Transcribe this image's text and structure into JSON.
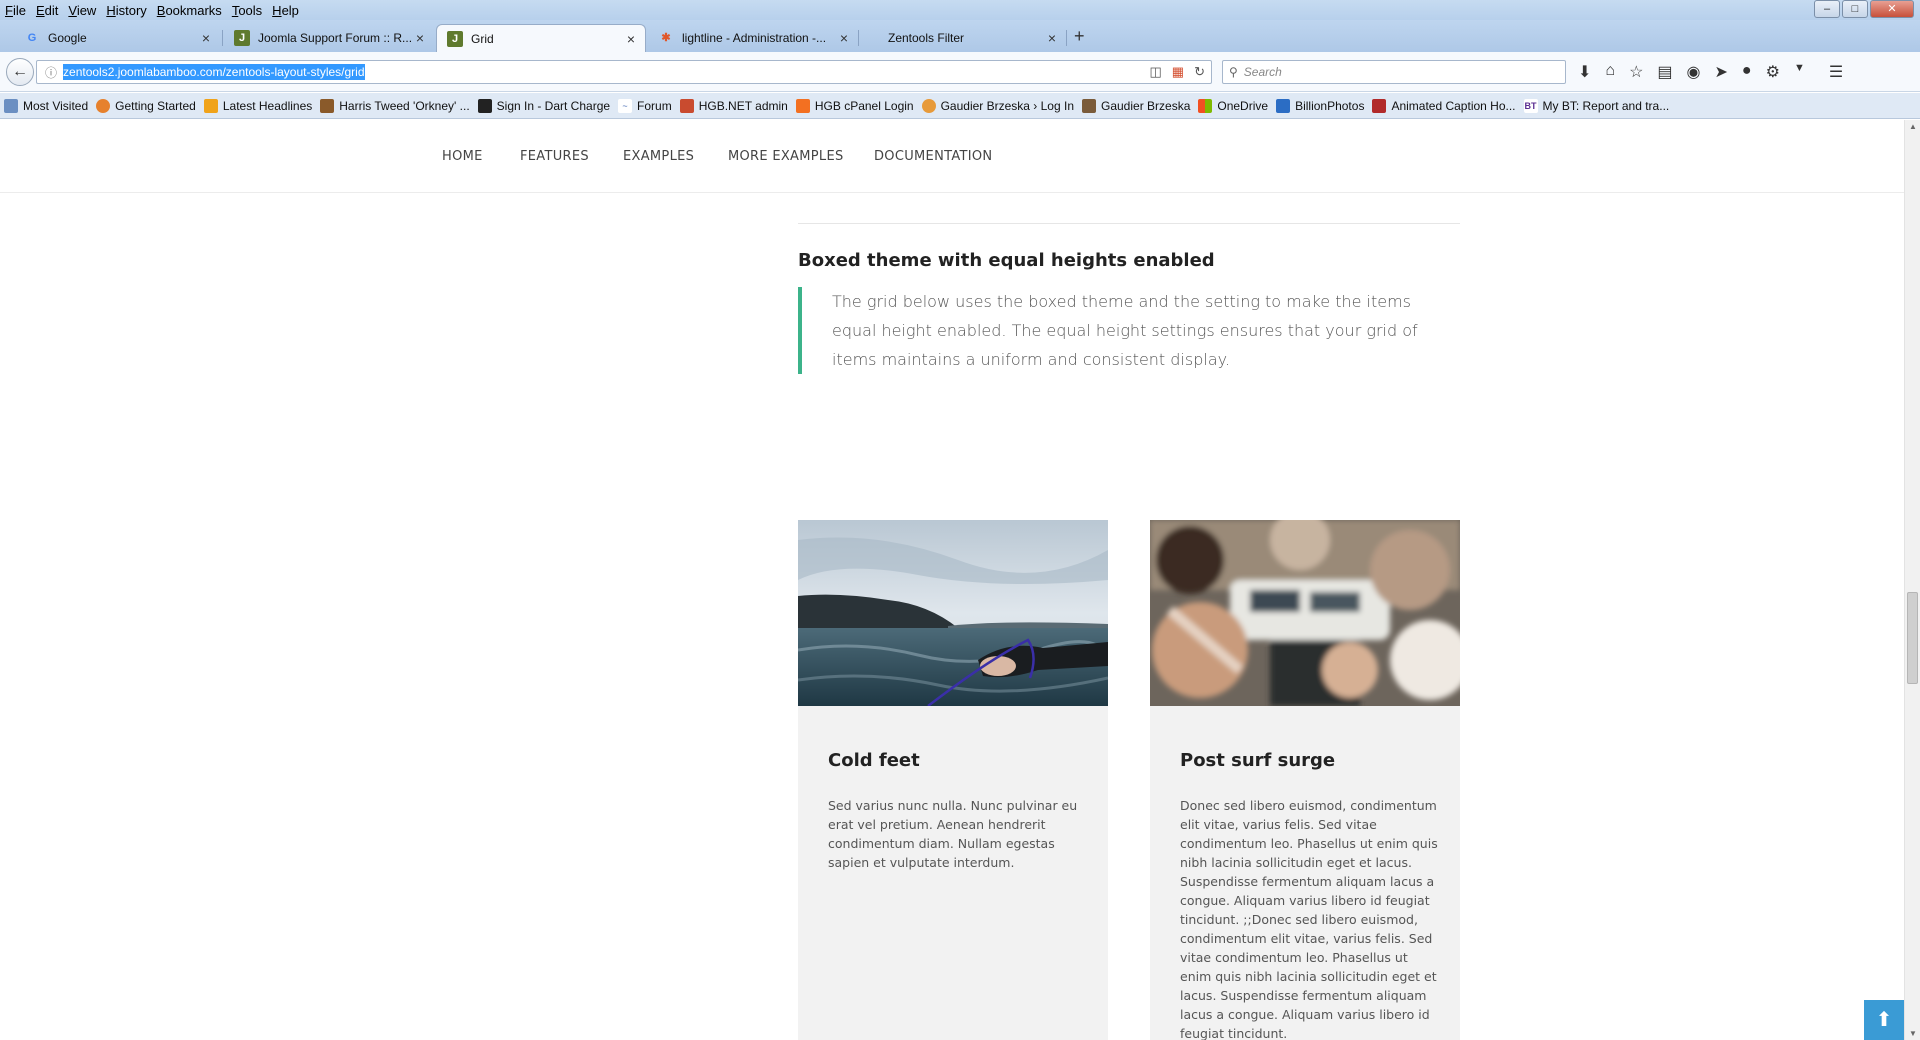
{
  "menubar": {
    "items": [
      "File",
      "Edit",
      "View",
      "History",
      "Bookmarks",
      "Tools",
      "Help"
    ]
  },
  "tabs": [
    {
      "label": "Google",
      "icon": "google-icon"
    },
    {
      "label": "Joomla Support Forum :: R...",
      "icon": "joomlabamboo-icon"
    },
    {
      "label": "Grid",
      "icon": "joomlabamboo-icon"
    },
    {
      "label": "lightline - Administration -...",
      "icon": "joomla-icon"
    },
    {
      "label": "Zentools Filter",
      "icon": "blank-icon"
    }
  ],
  "newtab": "+",
  "urlbar": {
    "url": "zentools2.joomlabamboo.com/zentools-layout-styles/grid"
  },
  "searchbar": {
    "placeholder": "Search"
  },
  "bookmarks": [
    "Most Visited",
    "Getting Started",
    "Latest Headlines",
    "Harris Tweed 'Orkney' ...",
    "Sign In - Dart Charge",
    "Forum",
    "HGB.NET admin",
    "HGB cPanel Login",
    "Gaudier Brzeska › Log In",
    "Gaudier Brzeska",
    "OneDrive",
    "BillionPhotos",
    "Animated Caption Ho...",
    "My BT: Report and tra..."
  ],
  "sitenav": [
    "HOME",
    "FEATURES",
    "EXAMPLES",
    "MORE EXAMPLES",
    "DOCUMENTATION"
  ],
  "section": {
    "heading": "Boxed theme with equal heights enabled",
    "quote": "The grid below uses the boxed theme and the setting to make the items equal height enabled. The equal height settings ensures that your grid of items maintains a uniform and consistent display."
  },
  "cards": [
    {
      "title": "Cold feet",
      "text": "Sed varius nunc nulla. Nunc pulvinar eu erat vel pretium. Aenean hendrerit condimentum diam. Nullam egestas sapien et vulputate interdum."
    },
    {
      "title": "Post surf surge",
      "text": "Donec sed libero euismod, condimentum elit vitae, varius felis. Sed vitae condimentum leo. Phasellus ut enim quis nibh lacinia sollicitudin eget et lacus. Suspendisse fermentum aliquam lacus a congue. Aliquam varius libero id feugiat tincidunt. ;;Donec sed libero euismod, condimentum elit vitae, varius felis. Sed vitae condimentum leo. Phasellus ut enim quis nibh lacinia sollicitudin eget et lacus. Suspendisse fermentum aliquam lacus a congue. Aliquam varius libero id feugiat tincidunt."
    }
  ],
  "colors": {
    "accent": "#3cb38a",
    "totop": "#3a9bd5",
    "card_bg": "#f2f2f2"
  }
}
